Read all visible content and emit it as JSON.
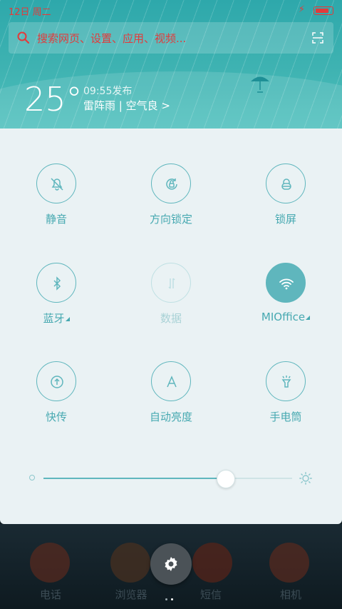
{
  "status_bar": {
    "date": "12日 周二"
  },
  "search": {
    "placeholder": "搜索网页、设置、应用、视频..."
  },
  "weather": {
    "temperature": "25°",
    "publish_time": "09:55发布",
    "description": "雷阵雨 | 空气良 >"
  },
  "quick_settings": {
    "row1": [
      {
        "label": "静音",
        "icon": "bell-off-icon",
        "state": "off"
      },
      {
        "label": "方向锁定",
        "icon": "rotation-lock-icon",
        "state": "off"
      },
      {
        "label": "锁屏",
        "icon": "lock-icon",
        "state": "off"
      }
    ],
    "row2": [
      {
        "label": "蓝牙",
        "icon": "bluetooth-icon",
        "state": "off"
      },
      {
        "label": "数据",
        "icon": "data-icon",
        "state": "disabled"
      },
      {
        "label": "MIOffice",
        "icon": "wifi-icon",
        "state": "on"
      }
    ],
    "row3": [
      {
        "label": "快传",
        "icon": "transfer-icon",
        "state": "off"
      },
      {
        "label": "自动亮度",
        "icon": "auto-brightness-icon",
        "state": "off"
      },
      {
        "label": "手电筒",
        "icon": "flashlight-icon",
        "state": "off"
      }
    ]
  },
  "brightness": {
    "value": 0.73
  },
  "dock": {
    "apps": [
      "电话",
      "浏览器",
      "短信",
      "相机"
    ]
  },
  "colors": {
    "accent": "#5fb6bd",
    "status_red": "#e23b3b"
  }
}
